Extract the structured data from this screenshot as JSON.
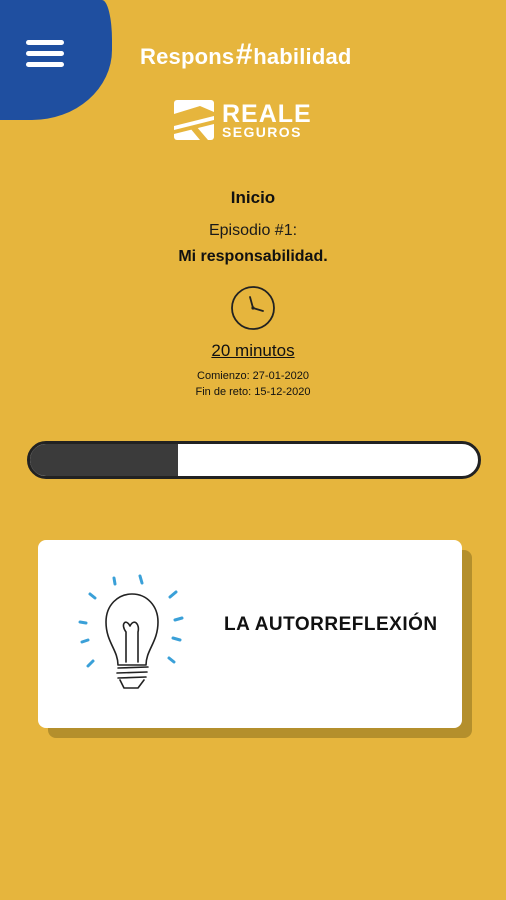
{
  "header": {
    "title_left": "Respons",
    "title_hash": "#",
    "title_right": "habilidad",
    "menu_icon": "hamburger-menu-icon"
  },
  "brand": {
    "line1": "REALE",
    "line2": "SEGUROS",
    "logo_icon": "reale-logo-icon"
  },
  "episode": {
    "section_label": "Inicio",
    "number_label": "Episodio #1:",
    "name": "Mi responsabilidad.",
    "clock_icon": "clock-icon",
    "duration": "20 minutos",
    "start_date": "Comienzo: 27-01-2020",
    "end_date": "Fin de reto: 15-12-2020"
  },
  "progress": {
    "percent": 33
  },
  "card": {
    "icon": "lightbulb-icon",
    "title": "LA AUTORREFLEXIÓN"
  },
  "colors": {
    "background": "#e6b53d",
    "menu_blob": "#1f4fa0",
    "progress_fill": "#3b3b3b",
    "bulb_rays": "#3aa0d8"
  }
}
